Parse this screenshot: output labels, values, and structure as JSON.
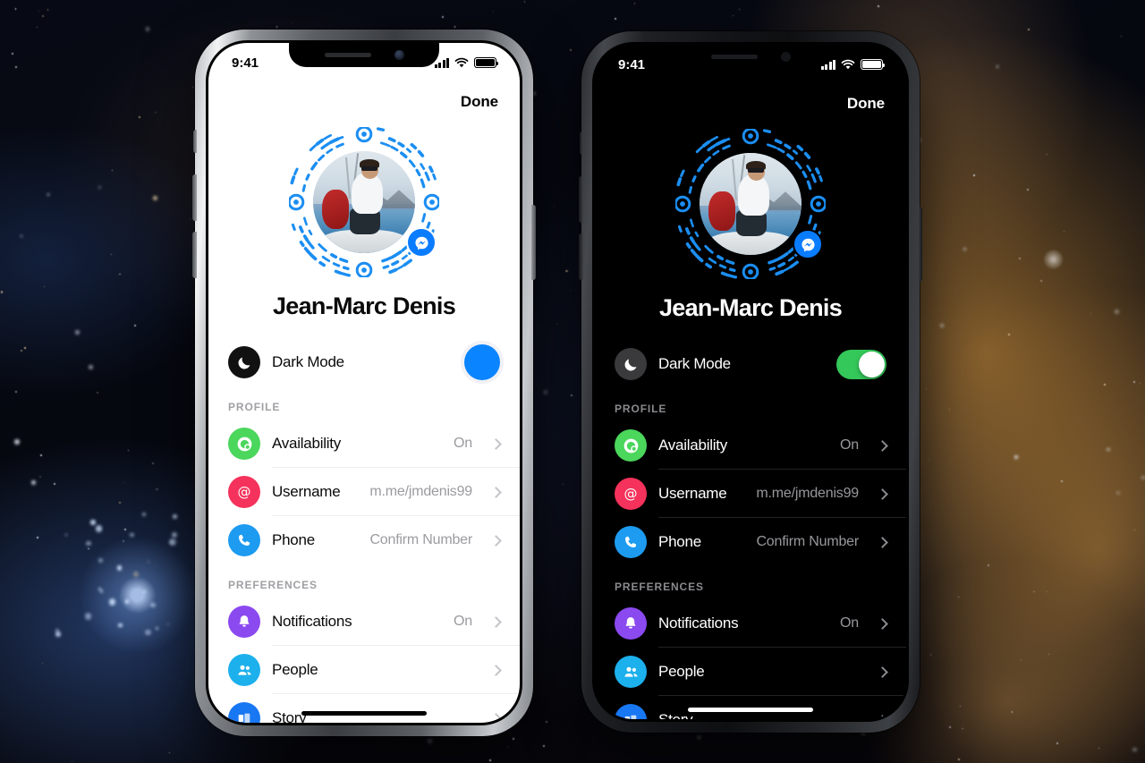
{
  "background": {
    "scene": "space-nebula",
    "colors": {
      "deep": "#070a14",
      "dust_warm": "#c88e46",
      "star_blue": "#bed7ff"
    }
  },
  "phones": [
    {
      "id": "light",
      "theme": "light",
      "status_bar": {
        "time": "9:41",
        "signal_icon": "cellular-bars-icon",
        "wifi_icon": "wifi-icon",
        "battery_icon": "battery-icon"
      },
      "nav": {
        "done_label": "Done"
      },
      "profile": {
        "name": "Jean-Marc Denis",
        "avatar_name": "profile-photo",
        "code_ring_name": "messenger-code-ring",
        "badge_name": "messenger-badge-icon"
      },
      "dark_mode": {
        "label": "Dark Mode",
        "icon": "moon-icon",
        "state": "off",
        "toggle_color": "#0a84ff"
      },
      "sections": [
        {
          "title": "PROFILE",
          "rows": [
            {
              "label": "Availability",
              "value": "On",
              "icon": "availability-icon",
              "icon_color": "#4bd65c"
            },
            {
              "label": "Username",
              "value": "m.me/jmdenis99",
              "icon": "at-sign-icon",
              "icon_color": "#f5325b"
            },
            {
              "label": "Phone",
              "value": "Confirm Number",
              "icon": "phone-icon",
              "icon_color": "#1d9bf0"
            }
          ]
        },
        {
          "title": "PREFERENCES",
          "rows": [
            {
              "label": "Notifications",
              "value": "On",
              "icon": "bell-icon",
              "icon_color": "#8b49f0"
            },
            {
              "label": "People",
              "value": "",
              "icon": "people-icon",
              "icon_color": "#1cb0ec"
            },
            {
              "label": "Story",
              "value": "",
              "icon": "story-icon",
              "icon_color": "#1877f2"
            }
          ]
        }
      ]
    },
    {
      "id": "dark",
      "theme": "dark",
      "status_bar": {
        "time": "9:41",
        "signal_icon": "cellular-bars-icon",
        "wifi_icon": "wifi-icon",
        "battery_icon": "battery-icon"
      },
      "nav": {
        "done_label": "Done"
      },
      "profile": {
        "name": "Jean-Marc Denis",
        "avatar_name": "profile-photo",
        "code_ring_name": "messenger-code-ring",
        "badge_name": "messenger-badge-icon"
      },
      "dark_mode": {
        "label": "Dark Mode",
        "icon": "moon-icon",
        "state": "on",
        "toggle_color": "#34c759"
      },
      "sections": [
        {
          "title": "PROFILE",
          "rows": [
            {
              "label": "Availability",
              "value": "On",
              "icon": "availability-icon",
              "icon_color": "#4bd65c"
            },
            {
              "label": "Username",
              "value": "m.me/jmdenis99",
              "icon": "at-sign-icon",
              "icon_color": "#f5325b"
            },
            {
              "label": "Phone",
              "value": "Confirm Number",
              "icon": "phone-icon",
              "icon_color": "#1d9bf0"
            }
          ]
        },
        {
          "title": "PREFERENCES",
          "rows": [
            {
              "label": "Notifications",
              "value": "On",
              "icon": "bell-icon",
              "icon_color": "#8b49f0"
            },
            {
              "label": "People",
              "value": "",
              "icon": "people-icon",
              "icon_color": "#1cb0ec"
            },
            {
              "label": "Story",
              "value": "",
              "icon": "story-icon",
              "icon_color": "#1877f2"
            }
          ]
        }
      ]
    }
  ]
}
